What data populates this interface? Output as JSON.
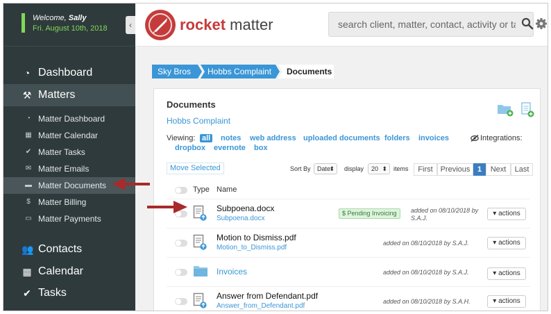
{
  "welcome": {
    "greeting": "Welcome,",
    "user": "Sally",
    "date": "Fri. August 10th, 2018"
  },
  "sidebar": {
    "collapse_glyph": "‹",
    "main": [
      {
        "label": "Dashboard",
        "icon": "dashboard-icon"
      },
      {
        "label": "Matters",
        "icon": "gavel-icon"
      }
    ],
    "sub": [
      {
        "label": "Matter Dashboard",
        "icon": "dashboard-icon"
      },
      {
        "label": "Matter Calendar",
        "icon": "calendar-icon"
      },
      {
        "label": "Matter Tasks",
        "icon": "check-icon"
      },
      {
        "label": "Matter Emails",
        "icon": "envelope-icon"
      },
      {
        "label": "Matter Documents",
        "icon": "folder-icon"
      },
      {
        "label": "Matter Billing",
        "icon": "dollar-icon"
      },
      {
        "label": "Matter Payments",
        "icon": "credit-card-icon"
      }
    ],
    "bottom": [
      {
        "label": "Contacts",
        "icon": "contacts-icon"
      },
      {
        "label": "Calendar",
        "icon": "calendar-icon"
      },
      {
        "label": "Tasks",
        "icon": "check-icon"
      }
    ]
  },
  "header": {
    "logo_word1": "rocket",
    "logo_word2": "matter",
    "search_placeholder": "search client, matter, contact, activity or tag"
  },
  "breadcrumb": [
    "Sky Bros",
    "Hobbs Complaint",
    "Documents"
  ],
  "documents": {
    "title": "Documents",
    "matter": "Hobbs Complaint",
    "viewing_label": "Viewing:",
    "filters": [
      "all",
      "notes",
      "web address",
      "uploaded documents",
      "folders",
      "invoices",
      "dropbox",
      "evernote",
      "box"
    ],
    "integrations_label": "Integrations:",
    "move_selected": "Move Selected",
    "sort_by_label": "Sort By",
    "sort_by_value": "Date",
    "display_label": "display",
    "display_value": "20",
    "items_label": "items",
    "pager": {
      "first": "First",
      "previous": "Previous",
      "current": "1",
      "next": "Next",
      "last": "Last"
    },
    "columns": {
      "type": "Type",
      "name": "Name"
    },
    "rows": [
      {
        "name": "Subpoena.docx",
        "file": "Subpoena.docx",
        "badge": "Pending Invoicing",
        "added": "added on 08/10/2018 by",
        "added_by": "S.A.J.",
        "actions": "actions"
      },
      {
        "name": "Motion to Dismiss.pdf",
        "file": "Motion_to_Dismiss.pdf",
        "added": "added on 08/10/2018 by S.A.J.",
        "actions": "actions"
      },
      {
        "name": "Invoices",
        "added": "added on 08/10/2018 by S.A.J.",
        "actions": "actions"
      },
      {
        "name": "Answer from Defendant.pdf",
        "file": "Answer_from_Defendant.pdf",
        "added": "added on 08/10/2018 by S.A.H.",
        "actions": "actions"
      }
    ]
  },
  "colors": {
    "sidebar_bg": "#2f3a3c",
    "accent_blue": "#3a96d6",
    "brand_red": "#c53b3b",
    "welcome_green": "#7ed957",
    "annotation_arrow": "#a82a2a"
  }
}
